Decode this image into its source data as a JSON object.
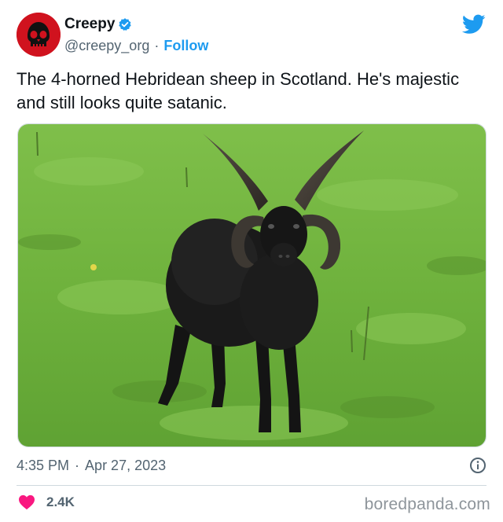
{
  "author": {
    "display_name": "Creepy",
    "handle": "@creepy_org",
    "separator": "·",
    "follow_label": "Follow",
    "avatar_icon": "skull-icon",
    "verified_icon": "verified-badge-icon"
  },
  "brand_icon": "twitter-bird-icon",
  "tweet": {
    "text": "The 4-horned Hebridean sheep in Scotland. He's majestic and still looks quite satanic."
  },
  "meta": {
    "time": "4:35 PM",
    "separator": "·",
    "date": "Apr 27, 2023",
    "info_icon": "info-icon"
  },
  "engagement": {
    "like_icon": "heart-icon",
    "likes": "2.4K"
  },
  "watermark": "boredpanda.com",
  "colors": {
    "accent": "#1d9bf0",
    "heart": "#f91880",
    "avatar_bg": "#d0121e",
    "text_secondary": "#536471"
  }
}
